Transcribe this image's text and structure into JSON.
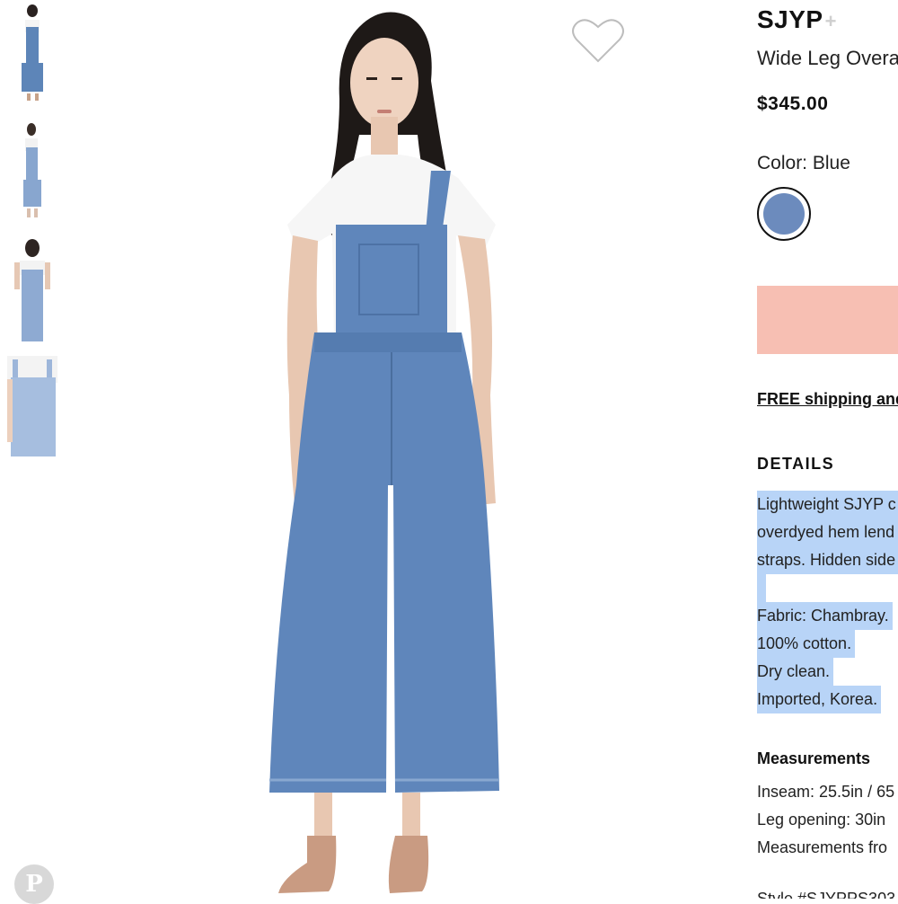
{
  "gallery": {
    "thumbnails": [
      "front-view",
      "side-view",
      "close-up-front",
      "detail-back"
    ],
    "selected_index": 0
  },
  "product": {
    "brand": "SJYP",
    "brand_plus": "+",
    "name": "Wide Leg Overa",
    "price": "$345.00",
    "color_label": "Color: Blue",
    "color_swatch_hex": "#6c8bbd",
    "add_button_color": "#f7bfb3",
    "shipping_link": "FREE shipping and"
  },
  "details": {
    "heading": "DETAILS",
    "description_lines": [
      "Lightweight SJYP c",
      "overdyed hem lend",
      "straps. Hidden side"
    ],
    "fabric_lines": [
      "Fabric: Chambray.",
      "100% cotton.",
      "Dry clean.",
      "Imported, Korea."
    ],
    "selection_highlight": "#b8d4f7"
  },
  "measurements": {
    "heading": "Measurements",
    "lines": [
      "Inseam: 25.5in / 65",
      "Leg opening: 30in",
      "Measurements fro"
    ],
    "style_cut": "Style #SJYPPS303"
  },
  "icons": {
    "favorite": "heart-outline-icon",
    "share": "pinterest-icon"
  }
}
